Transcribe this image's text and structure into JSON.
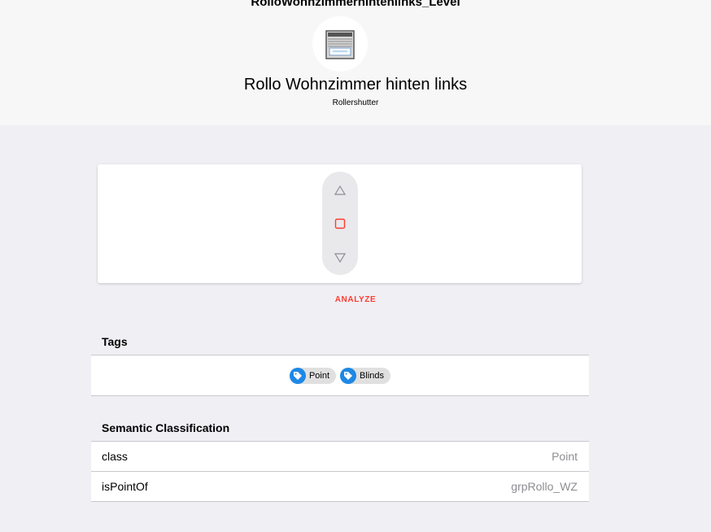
{
  "header": {
    "item_name": "RolloWohnzimmerhintenlinks_Level",
    "label": "Rollo Wohnzimmer hinten links",
    "type": "Rollershutter",
    "icon": "rollershutter-icon"
  },
  "controls": {
    "up_icon": "triangle-up-icon",
    "stop_icon": "square-stop-icon",
    "down_icon": "triangle-down-icon",
    "stop_color": "#ff3b30"
  },
  "analyze_label": "ANALYZE",
  "tags": {
    "title": "Tags",
    "items": [
      {
        "label": "Point",
        "icon": "tag-icon"
      },
      {
        "label": "Blinds",
        "icon": "tag-icon"
      }
    ]
  },
  "semantic": {
    "title": "Semantic Classification",
    "rows": [
      {
        "key": "class",
        "value": "Point"
      },
      {
        "key": "isPointOf",
        "value": "grpRollo_WZ"
      }
    ]
  },
  "colors": {
    "accent": "#ff3b30",
    "tag_blue": "#1e88e5",
    "background": "#efeff4"
  }
}
